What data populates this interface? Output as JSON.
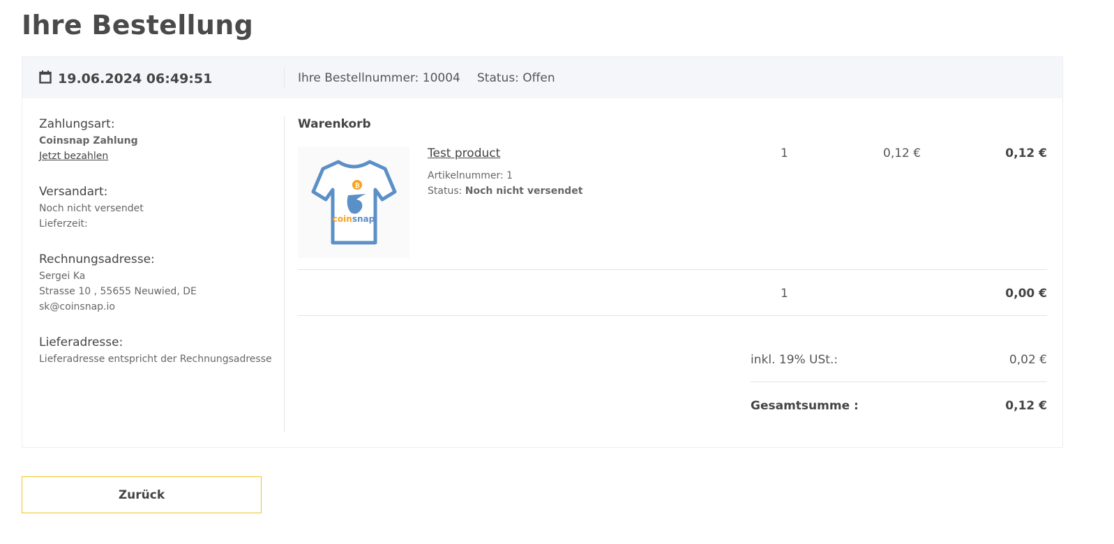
{
  "title": "Ihre Bestellung",
  "header": {
    "date": "19.06.2024 06:49:51",
    "order_number": "Ihre Bestellnummer: 10004",
    "status": "Status: Offen"
  },
  "left": {
    "payment_label": "Zahlungsart:",
    "payment_method": "Coinsnap Zahlung",
    "pay_now": "Jetzt bezahlen",
    "shipping_label": "Versandart:",
    "shipping_status": "Noch nicht versendet",
    "delivery_time": "Lieferzeit:",
    "billing_label": "Rechnungsadresse:",
    "billing_name": "Sergei Ka",
    "billing_street": "Strasse 10 , 55655 Neuwied, DE",
    "billing_email": "sk@coinsnap.io",
    "delivery_label": "Lieferadresse:",
    "delivery_text": "Lieferadresse entspricht der Rechnungsadresse"
  },
  "cart": {
    "title": "Warenkorb",
    "item": {
      "name": "Test product",
      "sku": "Artikelnummer: 1",
      "status_label": "Status:",
      "status_value": "Noch nicht versendet",
      "qty": "1",
      "price": "0,12 €",
      "total": "0,12 €",
      "image_logo_text": "coinsnap"
    },
    "shipping_row": {
      "qty": "1",
      "total": "0,00 €"
    },
    "tax_label": "inkl. 19% USt.:",
    "tax_value": "0,02 €",
    "grand_label": "Gesamtsumme :",
    "grand_value": "0,12 €"
  },
  "back_button": "Zurück",
  "colors": {
    "header_bg": "#f5f6fa",
    "button_border": "#f2c11c",
    "shirt": "#5b8fc7",
    "bitcoin": "#f7a21b"
  }
}
